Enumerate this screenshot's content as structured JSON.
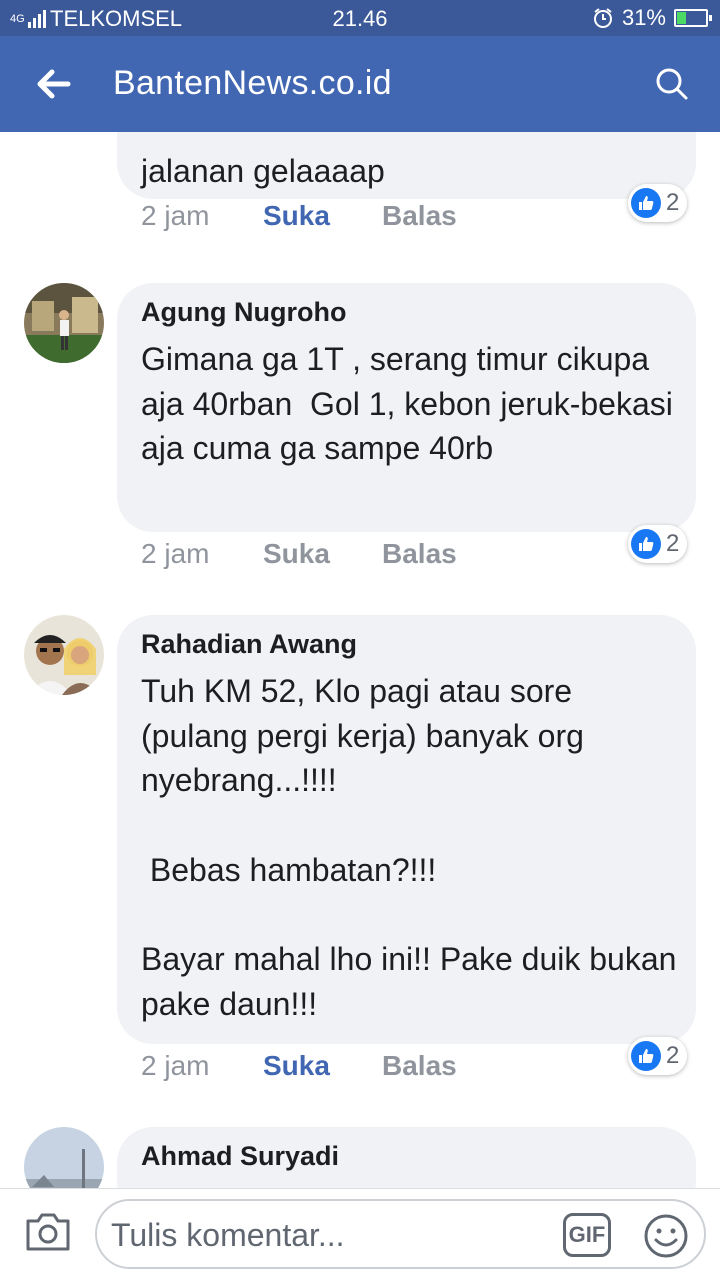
{
  "status_bar": {
    "network": "4G",
    "carrier": "TELKOMSEL",
    "time": "21.46",
    "battery_percent": "31%",
    "battery_level": 0.31
  },
  "app_bar": {
    "title": "BantenNews.co.id",
    "back_icon": "arrow-left-icon",
    "search_icon": "search-icon"
  },
  "comments": [
    {
      "author": "",
      "text": "jalanan gelaaaap",
      "time": "2 jam",
      "like_label": "Suka",
      "like_active": true,
      "reply_label": "Balas",
      "reaction_count": "2"
    },
    {
      "author": "Agung Nugroho",
      "text": "Gimana ga 1T , serang timur cikupa aja 40rban  Gol 1, kebon jeruk-bekasi aja cuma ga sampe 40rb",
      "time": "2 jam",
      "like_label": "Suka",
      "like_active": false,
      "reply_label": "Balas",
      "reaction_count": "2"
    },
    {
      "author": "Rahadian Awang",
      "text": "Tuh KM 52, Klo pagi atau sore (pulang pergi kerja) banyak org nyebrang...!!!!\n\n Bebas hambatan?!!!\n\nBayar mahal lho ini!! Pake duik bukan pake daun!!!",
      "time": "2 jam",
      "like_label": "Suka",
      "like_active": true,
      "reply_label": "Balas",
      "reaction_count": "2"
    },
    {
      "author": "Ahmad Suryadi",
      "text": "",
      "time": "",
      "like_label": "",
      "like_active": false,
      "reply_label": "",
      "reaction_count": ""
    }
  ],
  "composer": {
    "placeholder": "Tulis komentar...",
    "gif_label": "GIF",
    "camera_icon": "camera-icon",
    "emoji_icon": "smiley-icon"
  },
  "colors": {
    "status_bar_bg": "#3b5998",
    "app_bar_bg": "#4267b2",
    "bubble_bg": "#f0f2f5",
    "like_active": "#4267b2",
    "meta_text": "#90949c",
    "reaction_blue": "#1877f2"
  }
}
